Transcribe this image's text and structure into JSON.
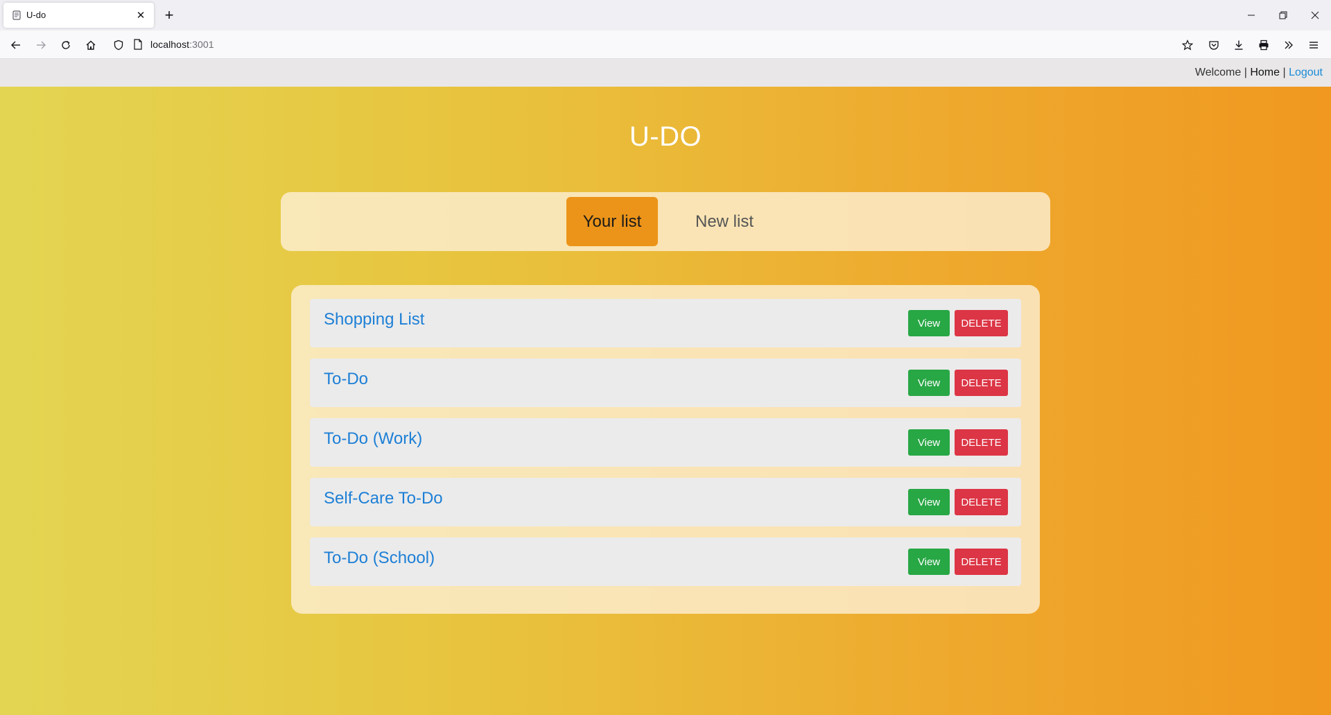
{
  "browser": {
    "tab_title": "U-do",
    "tab_close": "✕",
    "new_tab": "+",
    "url_host": "localhost",
    "url_port": ":3001"
  },
  "topnav": {
    "welcome": "Welcome",
    "sep1": " | ",
    "home": "Home",
    "sep2": " | ",
    "logout": "Logout"
  },
  "app": {
    "title": "U-DO"
  },
  "tabs": [
    {
      "label": "Your list",
      "active": true
    },
    {
      "label": "New list",
      "active": false
    }
  ],
  "lists": [
    {
      "name": "Shopping List",
      "view": "View",
      "delete": "DELETE"
    },
    {
      "name": "To-Do",
      "view": "View",
      "delete": "DELETE"
    },
    {
      "name": "To-Do (Work)",
      "view": "View",
      "delete": "DELETE"
    },
    {
      "name": "Self-Care To-Do",
      "view": "View",
      "delete": "DELETE"
    },
    {
      "name": "To-Do (School)",
      "view": "View",
      "delete": "DELETE"
    }
  ],
  "colors": {
    "accent_tab": "#ec9419",
    "view_button": "#28a745",
    "delete_button": "#dc3545",
    "link": "#1d7fd6"
  }
}
